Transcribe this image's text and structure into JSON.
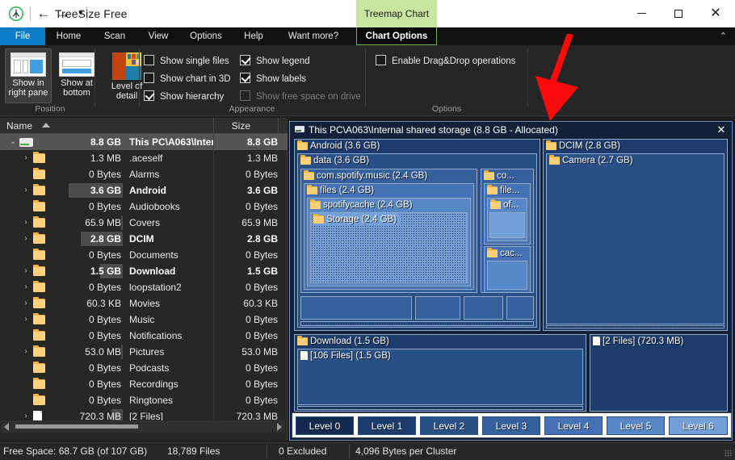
{
  "titlebar": {
    "app_title": "TreeSize Free",
    "logo_icon": "treesize-logo-icon",
    "back_icon": "←",
    "forward_icon": "→",
    "dropdown_icon": "▾",
    "treemap_tab": "Treemap Chart",
    "minimize_icon": "minimize-icon",
    "maximize_icon": "maximize-icon",
    "close_icon": "✕"
  },
  "ribbon_tabs": [
    {
      "label": "File",
      "active": true
    },
    {
      "label": "Home",
      "active": false
    },
    {
      "label": "Scan",
      "active": false
    },
    {
      "label": "View",
      "active": false
    },
    {
      "label": "Options",
      "active": false
    },
    {
      "label": "Help",
      "active": false
    },
    {
      "label": "Want more?",
      "active": false
    }
  ],
  "contextual_tab": {
    "label": "Chart Options"
  },
  "ribbon_collapse_icon": "⌃",
  "ribbon": {
    "groups": [
      {
        "name": "Position"
      },
      {
        "name": "Appearance"
      },
      {
        "name": "Options"
      }
    ],
    "position_buttons": [
      {
        "label_line1": "Show in",
        "label_line2": "right pane",
        "selected": true
      },
      {
        "label_line1": "Show at",
        "label_line2": "bottom",
        "selected": false
      }
    ],
    "level_of_detail": {
      "label_line1": "Level of",
      "label_line2": "detail"
    },
    "checkboxes": [
      {
        "label": "Show single files",
        "checked": false,
        "disabled": false
      },
      {
        "label": "Show chart in 3D",
        "checked": false,
        "disabled": false
      },
      {
        "label": "Show hierarchy",
        "checked": true,
        "disabled": false
      },
      {
        "label": "Show legend",
        "checked": true,
        "disabled": false
      },
      {
        "label": "Show labels",
        "checked": true,
        "disabled": false
      },
      {
        "label": "Show free space on drive",
        "checked": false,
        "disabled": true
      },
      {
        "label": "Enable Drag&Drop operations",
        "checked": false,
        "disabled": false
      }
    ]
  },
  "tree": {
    "columns": {
      "name": "Name",
      "size": "Size"
    },
    "sort_indicator": "ascending",
    "rows": [
      {
        "size": "8.8 GB",
        "name": "This PC\\A063\\Inter...",
        "size2": "8.8 GB",
        "icon": "drive-icon",
        "expander": "expanded",
        "bar": 0,
        "bold": true,
        "selected": true
      },
      {
        "size": "1.3 MB",
        "name": ".aceself",
        "size2": "1.3 MB",
        "icon": "folder-icon",
        "expander": "collapsed",
        "bar": 0,
        "bold": false,
        "selected": false
      },
      {
        "size": "0 Bytes",
        "name": "Alarms",
        "size2": "0 Bytes",
        "icon": "folder-icon",
        "expander": "none",
        "bar": 0,
        "bold": false,
        "selected": false
      },
      {
        "size": "3.6 GB",
        "name": "Android",
        "size2": "3.6 GB",
        "icon": "folder-icon",
        "expander": "collapsed",
        "bar": 68,
        "bold": true,
        "selected": false
      },
      {
        "size": "0 Bytes",
        "name": "Audiobooks",
        "size2": "0 Bytes",
        "icon": "folder-icon",
        "expander": "none",
        "bar": 0,
        "bold": false,
        "selected": false
      },
      {
        "size": "65.9 MB",
        "name": "Covers",
        "size2": "65.9 MB",
        "icon": "folder-icon",
        "expander": "collapsed",
        "bar": 2,
        "bold": false,
        "selected": false
      },
      {
        "size": "2.8 GB",
        "name": "DCIM",
        "size2": "2.8 GB",
        "icon": "folder-icon",
        "expander": "collapsed",
        "bar": 53,
        "bold": true,
        "selected": false
      },
      {
        "size": "0 Bytes",
        "name": "Documents",
        "size2": "0 Bytes",
        "icon": "folder-icon",
        "expander": "none",
        "bar": 0,
        "bold": false,
        "selected": false
      },
      {
        "size": "1.5 GB",
        "name": "Download",
        "size2": "1.5 GB",
        "icon": "folder-icon",
        "expander": "collapsed",
        "bar": 29,
        "bold": true,
        "selected": false
      },
      {
        "size": "0 Bytes",
        "name": "loopstation2",
        "size2": "0 Bytes",
        "icon": "folder-icon",
        "expander": "collapsed",
        "bar": 0,
        "bold": false,
        "selected": false
      },
      {
        "size": "60.3 KB",
        "name": "Movies",
        "size2": "60.3 KB",
        "icon": "folder-icon",
        "expander": "collapsed",
        "bar": 0,
        "bold": false,
        "selected": false
      },
      {
        "size": "0 Bytes",
        "name": "Music",
        "size2": "0 Bytes",
        "icon": "folder-icon",
        "expander": "collapsed",
        "bar": 0,
        "bold": false,
        "selected": false
      },
      {
        "size": "0 Bytes",
        "name": "Notifications",
        "size2": "0 Bytes",
        "icon": "folder-icon",
        "expander": "none",
        "bar": 0,
        "bold": false,
        "selected": false
      },
      {
        "size": "53.0 MB",
        "name": "Pictures",
        "size2": "53.0 MB",
        "icon": "folder-icon",
        "expander": "collapsed",
        "bar": 2,
        "bold": false,
        "selected": false
      },
      {
        "size": "0 Bytes",
        "name": "Podcasts",
        "size2": "0 Bytes",
        "icon": "folder-icon",
        "expander": "none",
        "bar": 0,
        "bold": false,
        "selected": false
      },
      {
        "size": "0 Bytes",
        "name": "Recordings",
        "size2": "0 Bytes",
        "icon": "folder-icon",
        "expander": "none",
        "bar": 0,
        "bold": false,
        "selected": false
      },
      {
        "size": "0 Bytes",
        "name": "Ringtones",
        "size2": "0 Bytes",
        "icon": "folder-icon",
        "expander": "none",
        "bar": 0,
        "bold": false,
        "selected": false
      },
      {
        "size": "720.3 MB",
        "name": "[2 Files]",
        "size2": "720.3 MB",
        "icon": "file-icon",
        "expander": "collapsed",
        "bar": 14,
        "bold": false,
        "selected": false
      }
    ]
  },
  "treemap": {
    "header": "This PC\\A063\\Internal shared storage (8.8 GB - Allocated)",
    "header_icon": "drive-icon",
    "close_icon": "✕",
    "tiles": [
      {
        "label": "Android (3.6 GB)",
        "icon": "folder-icon",
        "level": 1
      },
      {
        "label": "data (3.6 GB)",
        "icon": "folder-icon",
        "level": 2
      },
      {
        "label": "com.spotify.music (2.4 GB)",
        "icon": "folder-icon",
        "level": 3
      },
      {
        "label": "files (2.4 GB)",
        "icon": "folder-icon",
        "level": 4
      },
      {
        "label": "spotifycache (2.4 GB)",
        "icon": "folder-icon",
        "level": 5
      },
      {
        "label": "Storage (2.4 GB)",
        "icon": "folder-icon",
        "level": 6
      },
      {
        "label": "co...",
        "icon": "folder-icon",
        "level": 3
      },
      {
        "label": "file...",
        "icon": "folder-icon",
        "level": 4
      },
      {
        "label": "of...",
        "icon": "folder-icon",
        "level": 5
      },
      {
        "label": "cac...",
        "icon": "folder-icon",
        "level": 4
      },
      {
        "label": "DCIM (2.8 GB)",
        "icon": "folder-icon",
        "level": 1
      },
      {
        "label": "Camera (2.7 GB)",
        "icon": "folder-icon",
        "level": 2
      },
      {
        "label": "Download (1.5 GB)",
        "icon": "folder-icon",
        "level": 1
      },
      {
        "label": "[106 Files] (1.5 GB)",
        "icon": "file-icon",
        "level": 2
      },
      {
        "label": "[2 Files] (720.3 MB)",
        "icon": "file-icon",
        "level": 1
      }
    ],
    "legend": [
      {
        "label": "Level 0",
        "color": "#13294f"
      },
      {
        "label": "Level 1",
        "color": "#1d3c6e"
      },
      {
        "label": "Level 2",
        "color": "#2a5088"
      },
      {
        "label": "Level 3",
        "color": "#35609d"
      },
      {
        "label": "Level 4",
        "color": "#4472b4"
      },
      {
        "label": "Level 5",
        "color": "#5787c6"
      },
      {
        "label": "Level 6",
        "color": "#73a0da"
      }
    ]
  },
  "status": {
    "free_space": "Free Space: 68.7 GB  (of 107 GB)",
    "files": "18,789 Files",
    "excluded": "0 Excluded",
    "cluster": "4,096 Bytes per Cluster"
  },
  "annotation": {
    "arrow_color": "#fa0a0a",
    "arrow_icon": "red-arrow-annotation"
  }
}
